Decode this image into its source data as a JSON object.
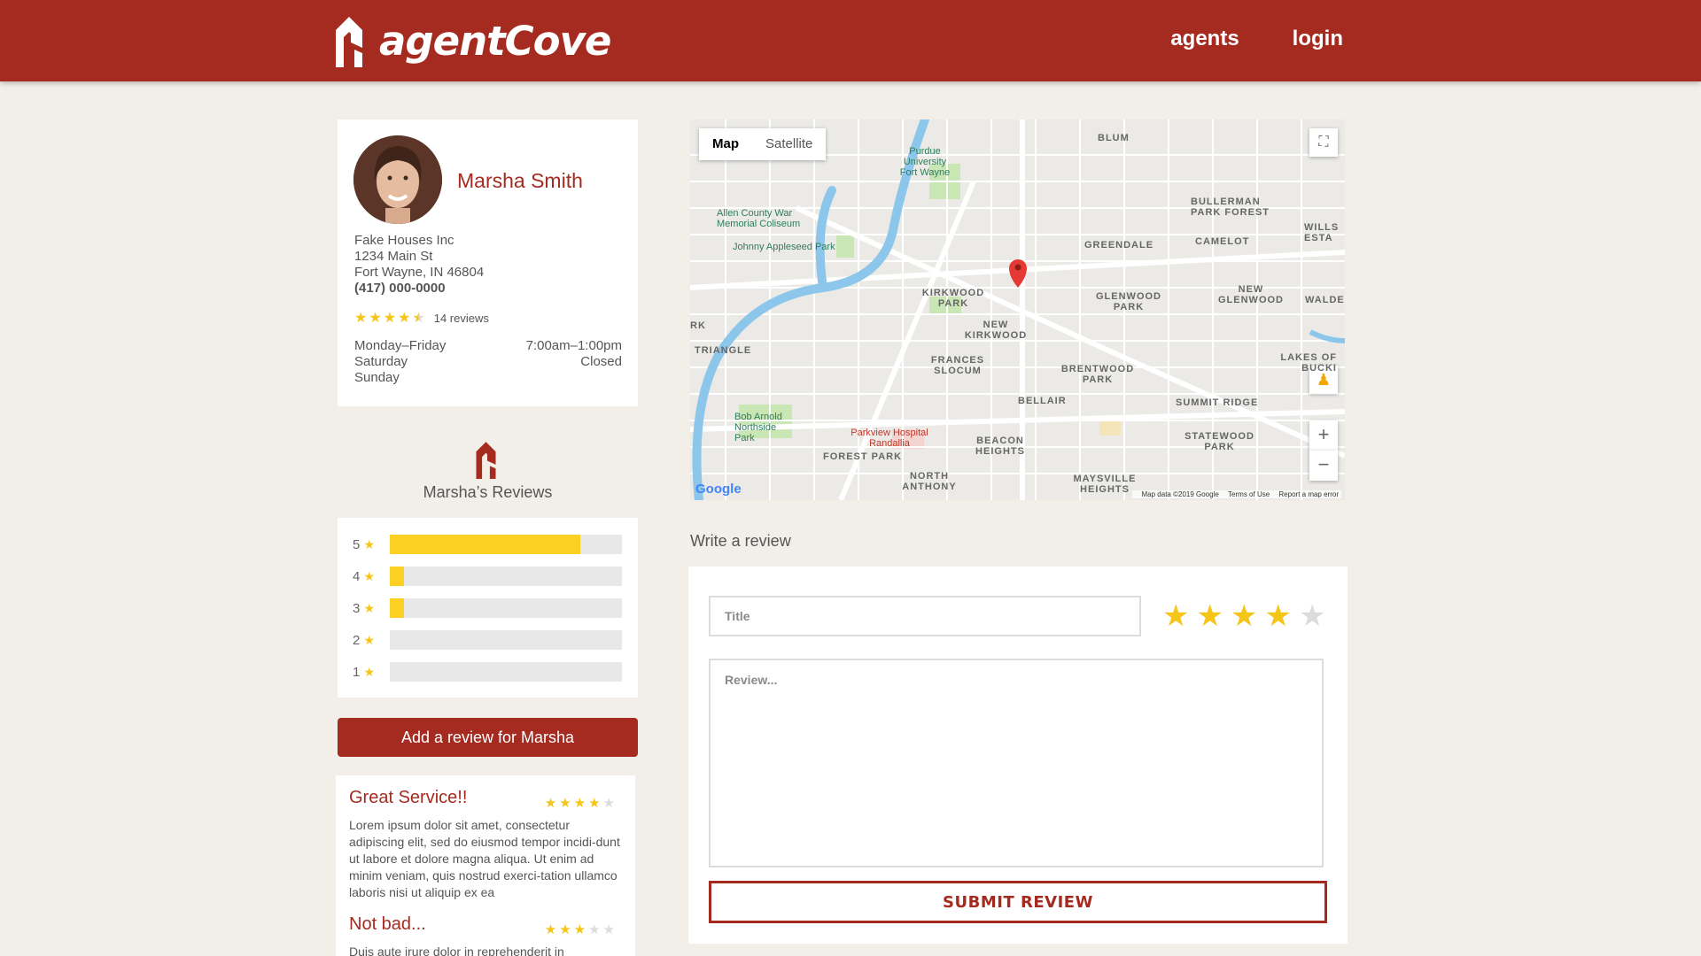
{
  "header": {
    "brand": "agentCove",
    "nav": [
      {
        "label": "agents"
      },
      {
        "label": "login"
      }
    ]
  },
  "profile": {
    "name": "Marsha Smith",
    "company": "Fake Houses Inc",
    "street": "1234 Main St",
    "city": "Fort Wayne, IN 46804",
    "phone": "(417) 000-0000",
    "rating": 4.5,
    "reviews_count": "14 reviews",
    "hours": [
      {
        "day": "Monday–Friday",
        "time": "7:00am–1:00pm"
      },
      {
        "day": "Saturday",
        "time": "Closed"
      },
      {
        "day": "Sunday",
        "time": ""
      }
    ]
  },
  "reviews_section": {
    "heading": "Marsha’s Reviews",
    "histogram": [
      {
        "label": "5",
        "fraction": 0.82
      },
      {
        "label": "4",
        "fraction": 0.06
      },
      {
        "label": "3",
        "fraction": 0.06
      },
      {
        "label": "2",
        "fraction": 0
      },
      {
        "label": "1",
        "fraction": 0
      }
    ],
    "add_button": "Add a review for Marsha",
    "items": [
      {
        "title": "Great Service!!",
        "stars": 4,
        "body": "Lorem ipsum dolor sit amet, consectetur adipiscing elit, sed do eiusmod tempor incidi-dunt ut labore et dolore magna aliqua. Ut enim ad minim veniam, quis nostrud exerci-tation ullamco laboris nisi ut aliquip ex ea"
      },
      {
        "title": "Not bad...",
        "stars": 3,
        "body": "Duis aute irure dolor in reprehenderit in"
      }
    ]
  },
  "map": {
    "toggle": {
      "map": "Map",
      "satellite": "Satellite"
    },
    "labels": {
      "blum": "BLUM",
      "purdue": "Purdue University Fort Wayne",
      "allen": "Allen County War Memorial Coliseum",
      "johnny": "Johnny Appleseed Park",
      "bullerman": "BULLERMAN PARK FOREST",
      "camelot": "CAMELOT",
      "greendale": "GREENDALE",
      "wills": "WILLS ESTA",
      "kirkwood": "KIRKWOOD PARK",
      "newkirkwood": "NEW KIRKWOOD",
      "glenwood": "GLENWOOD PARK",
      "newglenwood": "NEW GLENWOOD",
      "walden": "WALDE",
      "triangle": "TRIANGLE",
      "rk": "RK",
      "frances": "FRANCES SLOCUM",
      "brentwood": "BRENTWOOD PARK",
      "lakes": "LAKES OF BUCKI",
      "bellair": "BELLAIR",
      "summit": "SUMMIT RIDGE",
      "bobarnold": "Bob Arnold Northside Park",
      "parkview": "Parkview Hospital Randallia",
      "beacon": "BEACON HEIGHTS",
      "statewood": "STATEWOOD PARK",
      "forest": "FOREST PARK",
      "north": "NORTH ANTHONY",
      "maysville": "MAYSVILLE HEIGHTS"
    },
    "google": "Google",
    "footer": {
      "data": "Map data ©2019 Google",
      "terms": "Terms of Use",
      "report": "Report a map error"
    }
  },
  "write_review": {
    "heading": "Write a review",
    "title_placeholder": "Title",
    "review_placeholder": "Review...",
    "rating": 4,
    "submit": "SUBMIT REVIEW"
  },
  "colors": {
    "brand": "#a52b20",
    "star": "#f5c518",
    "bar": "#fcd021",
    "bg": "#f2efe8"
  }
}
